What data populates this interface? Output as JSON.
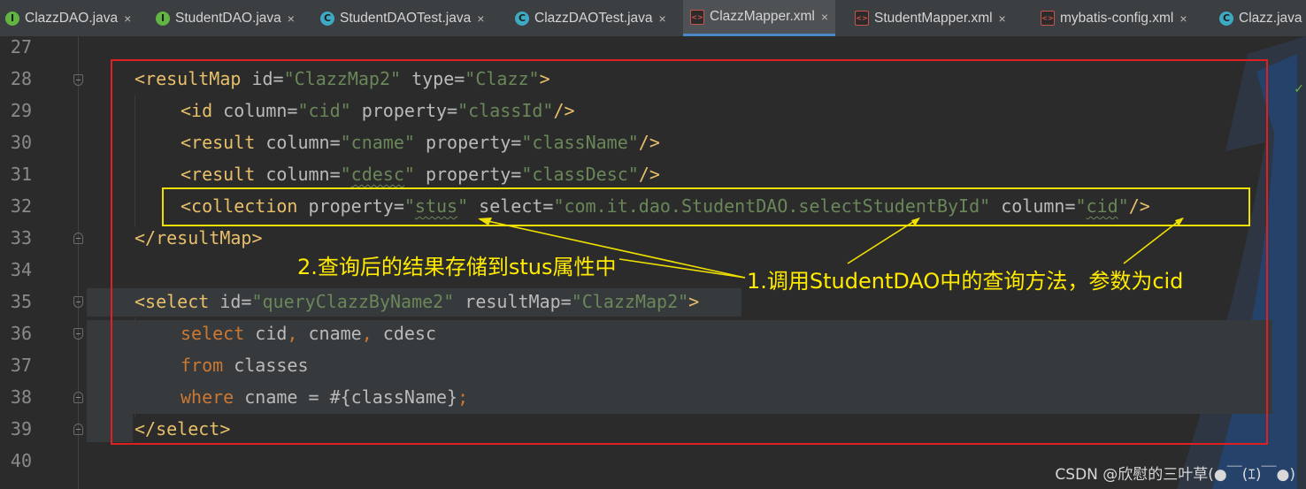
{
  "tabs": [
    {
      "label": "ClazzDAO.java",
      "icon": "interface-icon",
      "glyph": "I"
    },
    {
      "label": "StudentDAO.java",
      "icon": "interface-icon",
      "glyph": "I"
    },
    {
      "label": "StudentDAOTest.java",
      "icon": "class-icon",
      "glyph": "C"
    },
    {
      "label": "ClazzDAOTest.java",
      "icon": "class-icon",
      "glyph": "C"
    },
    {
      "label": "ClazzMapper.xml",
      "icon": "xml-icon",
      "glyph": "<>"
    },
    {
      "label": "StudentMapper.xml",
      "icon": "xml-icon",
      "glyph": "<>"
    },
    {
      "label": "mybatis-config.xml",
      "icon": "xml-icon",
      "glyph": "<>"
    },
    {
      "label": "Clazz.java",
      "icon": "class-icon",
      "glyph": "C"
    }
  ],
  "active_tab": "ClazzMapper.xml",
  "close_glyph": "×",
  "line_numbers": [
    "27",
    "28",
    "29",
    "30",
    "31",
    "32",
    "33",
    "34",
    "35",
    "36",
    "37",
    "38",
    "39",
    "40"
  ],
  "code": {
    "l28": {
      "open": "<resultMap",
      "a1": " id=",
      "v1": "\"ClazzMap2\"",
      "a2": " type=",
      "v2": "\"Clazz\"",
      "close": ">"
    },
    "l29": {
      "open": "<id",
      "a1": " column=",
      "v1": "\"cid\"",
      "a2": " property=",
      "v2": "\"classId\"",
      "close": "/>"
    },
    "l30": {
      "open": "<result",
      "a1": " column=",
      "v1": "\"cname\"",
      "a2": " property=",
      "v2": "\"className\"",
      "close": "/>"
    },
    "l31": {
      "open": "<result",
      "a1": " column=",
      "v1q": "\"",
      "v1": "cdesc",
      "v1e": "\"",
      "a2": " property=",
      "v2": "\"classDesc\"",
      "close": "/>"
    },
    "l32": {
      "open": "<collection",
      "a1": " property=",
      "v1q": "\"",
      "v1": "stus",
      "v1e": "\"",
      "a2": " select=",
      "v2": "\"com.it.dao.StudentDAO.selectStudentById\"",
      "a3": " column=",
      "v3q": "\"",
      "v3": "cid",
      "v3e": "\"",
      "close": "/>"
    },
    "l33": {
      "text": "</resultMap>"
    },
    "l35": {
      "open": "<select",
      "a1": " id=",
      "v1": "\"queryClazzByName2\"",
      "a2": " resultMap=",
      "v2": "\"ClazzMap2\"",
      "close": ">"
    },
    "l36": {
      "kw": "select",
      "rest1": " cid",
      "c1": ",",
      "rest2": " cname",
      "c2": ",",
      "rest3": " cdesc"
    },
    "l37": {
      "kw": "from",
      "rest": " classes"
    },
    "l38": {
      "kw": "where",
      "rest": " cname = #{className}",
      "semi": ";"
    },
    "l39": {
      "text": "</select>"
    }
  },
  "annotations": {
    "note_result": "2.查询后的结果存储到stus属性中",
    "note_call": "1.调用StudentDAO中的查询方法，参数为cid"
  },
  "watermark": "CSDN @欣慰的三叶草(●￣(ｴ)￣●)",
  "colors": {
    "annotation": "#ffea00",
    "outer_box": "#e02020",
    "tag": "#e8bf6a",
    "string": "#6a8759",
    "keyword": "#cc7832"
  }
}
